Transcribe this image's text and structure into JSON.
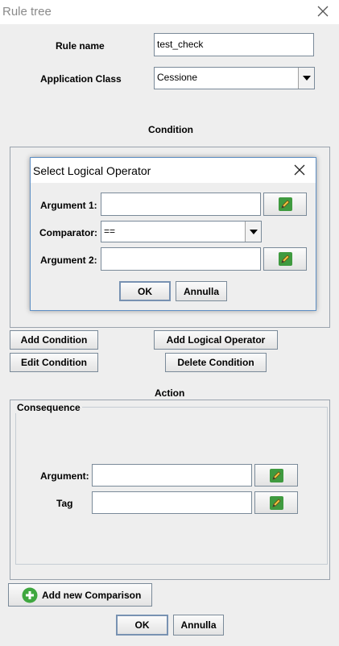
{
  "window": {
    "title": "Rule tree"
  },
  "form": {
    "rule_name_label": "Rule name",
    "rule_name_value": "test_check",
    "app_class_label": "Application Class",
    "app_class_value": "Cessione"
  },
  "condition": {
    "heading": "Condition",
    "buttons": {
      "add_condition": "Add Condition",
      "add_logical_operator": "Add Logical Operator",
      "edit_condition": "Edit Condition",
      "delete_condition": "Delete Condition"
    }
  },
  "dialog": {
    "title": "Select Logical Operator",
    "argument1_label": "Argument 1:",
    "argument1_value": "",
    "comparator_label": "Comparator:",
    "comparator_value": "==",
    "argument2_label": "Argument 2:",
    "argument2_value": "",
    "ok": "OK",
    "cancel": "Annulla"
  },
  "action": {
    "heading": "Action",
    "consequence_title": "Consequence",
    "argument_label": "Argument:",
    "argument_value": "",
    "tag_label": "Tag",
    "tag_value": "",
    "add_comparison": "Add new Comparison"
  },
  "footer": {
    "ok": "OK",
    "cancel": "Annulla"
  },
  "colors": {
    "accent_green": "#3f9a3f",
    "dialog_border": "#5e8fc4"
  },
  "icons": [
    "close-icon",
    "pencil-icon",
    "add-icon",
    "chevron-down-icon"
  ]
}
